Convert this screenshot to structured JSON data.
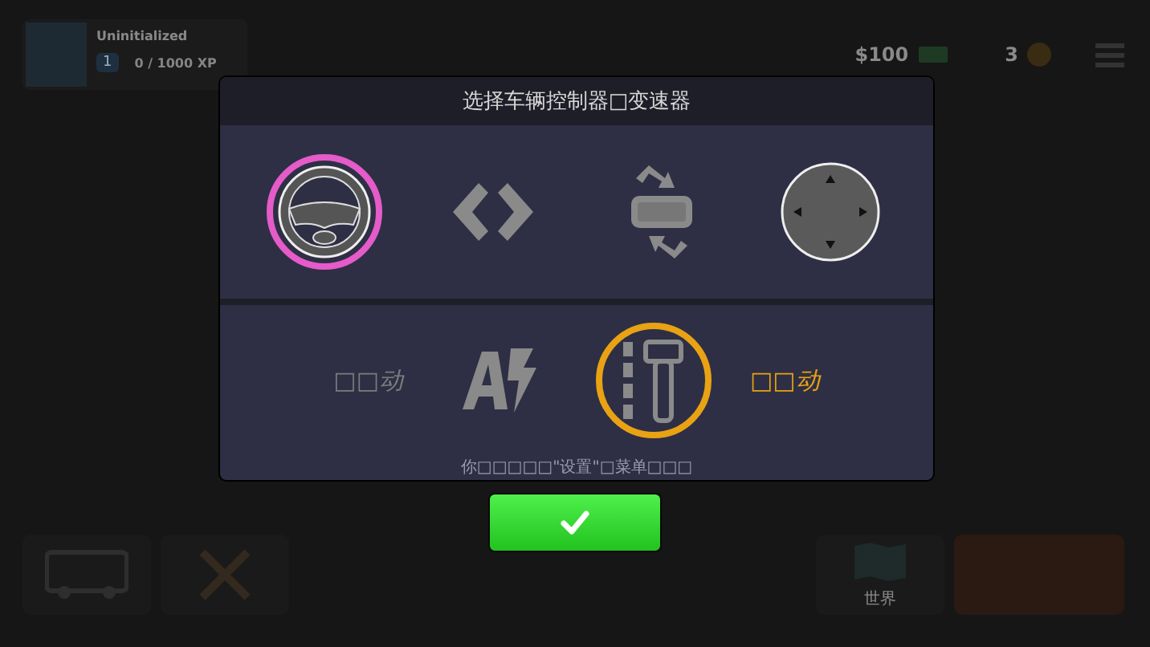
{
  "profile": {
    "name": "Uninitialized",
    "level": "1",
    "xp": "0 / 1000 XP"
  },
  "currency": {
    "money": "$100",
    "coins": "3"
  },
  "world_tile": {
    "label": "世界"
  },
  "dialog": {
    "title": "选择车辆控制器□变速器",
    "controls": [
      {
        "kind": "wheel",
        "selected": true
      },
      {
        "kind": "arrows",
        "selected": false
      },
      {
        "kind": "tilt",
        "selected": false
      },
      {
        "kind": "joystick",
        "selected": false
      }
    ],
    "transmissions": [
      {
        "kind": "auto",
        "label": "□□动",
        "selected": false
      },
      {
        "kind": "manual",
        "label": "□□动",
        "selected": true
      }
    ],
    "hint": "你□□□□□\"设置\"□菜单□□□"
  }
}
